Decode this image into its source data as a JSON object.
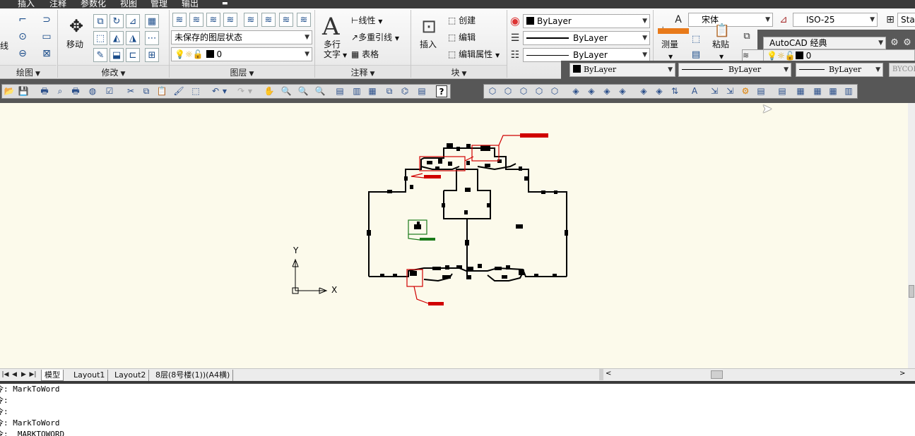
{
  "menu_tabs": [
    "插入",
    "注释",
    "参数化",
    "视图",
    "管理",
    "输出"
  ],
  "ribbon": {
    "draw": {
      "title": "绘图",
      "line_label": "线"
    },
    "modify": {
      "title": "修改",
      "move_label": "移动"
    },
    "layers": {
      "title": "图层",
      "layer_state": "未保存的图层状态",
      "current_layer": "0"
    },
    "annotation": {
      "title": "注释",
      "text_label_1": "多行",
      "text_label_2": "文字",
      "linear_label": "线性",
      "mleader_label": "多重引线",
      "table_label": "表格"
    },
    "block": {
      "title": "块",
      "insert_label": "插入",
      "create_label": "创建",
      "edit_label": "编辑",
      "edit_attr_label": "编辑属性"
    },
    "properties": {
      "color": "ByLayer",
      "linetype": "ByLayer",
      "lineweight": "ByLayer"
    },
    "measure_label": "测量",
    "paste_label": "粘贴",
    "text_style": "宋体",
    "dim_style": "ISO-25",
    "table_style": "Sta",
    "workspace": "AutoCAD 经典",
    "layer_small": "0"
  },
  "props_bar": {
    "color": "ByLayer",
    "linetype": "ByLayer",
    "lineweight": "ByLayer",
    "plot_style": "BYCOL"
  },
  "layout_tabs": [
    "模型",
    "Layout1",
    "Layout2",
    "8层(8号楼(1))(A4横)"
  ],
  "command_lines": [
    "令: MarkToWord",
    "令:",
    "令:",
    "令: MarkToWord",
    "令: _MARKTOWORD"
  ],
  "ucs": {
    "y": "Y",
    "x": "X"
  },
  "colors": {
    "canvas": "#fcfaeb",
    "markup_red": "#d00000",
    "markup_green": "#1a7a1a"
  }
}
